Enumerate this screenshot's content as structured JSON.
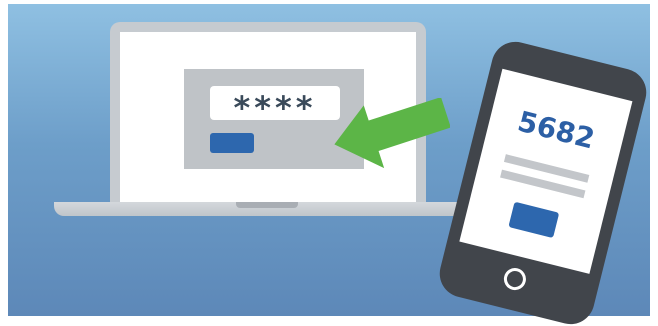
{
  "laptop": {
    "password_mask": "****"
  },
  "phone": {
    "code": "5682"
  },
  "icons": {
    "arrow": "arrow-left-icon",
    "home": "home-button-icon"
  },
  "colors": {
    "background": "#7aa9d2",
    "accent_blue": "#2d67ae",
    "arrow_green": "#5cb547",
    "device_dark": "#41454b",
    "device_light": "#c6cbd0"
  }
}
